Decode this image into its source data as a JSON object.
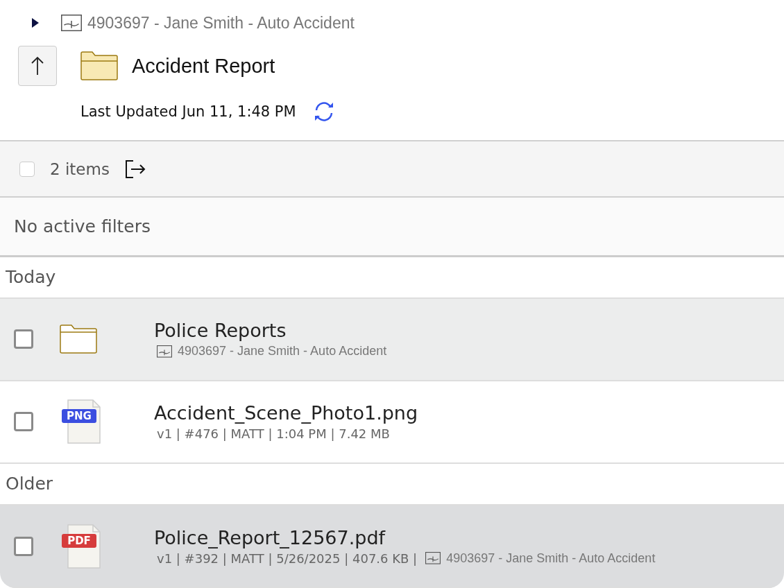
{
  "breadcrumb": {
    "expanded": false,
    "case": "4903697 - Jane Smith - Auto Accident"
  },
  "folder": {
    "title": "Accident Report",
    "last_updated": "Last Updated Jun 11, 1:48 PM"
  },
  "toolbar": {
    "checked": false,
    "count": "2 items"
  },
  "filters": "No active filters",
  "groups": [
    {
      "label": "Today",
      "rows": [
        {
          "kind": "folder",
          "name": "Police Reports",
          "case": "4903697 - Jane Smith - Auto Accident",
          "checked": false,
          "selected": false
        },
        {
          "kind": "png",
          "badge": "PNG",
          "name": "Accident_Scene_Photo1.png",
          "meta": "v1 | #476 | MATT | 1:04 PM | 7.42 MB",
          "checked": false,
          "selected": false
        }
      ]
    },
    {
      "label": "Older",
      "rows": [
        {
          "kind": "pdf",
          "badge": "PDF",
          "name": "Police_Report_12567.pdf",
          "meta": "v1 | #392 | MATT | 5/26/2025 | 407.6 KB |",
          "case": "4903697 - Jane Smith - Auto Accident",
          "checked": false,
          "selected": true
        }
      ]
    }
  ]
}
